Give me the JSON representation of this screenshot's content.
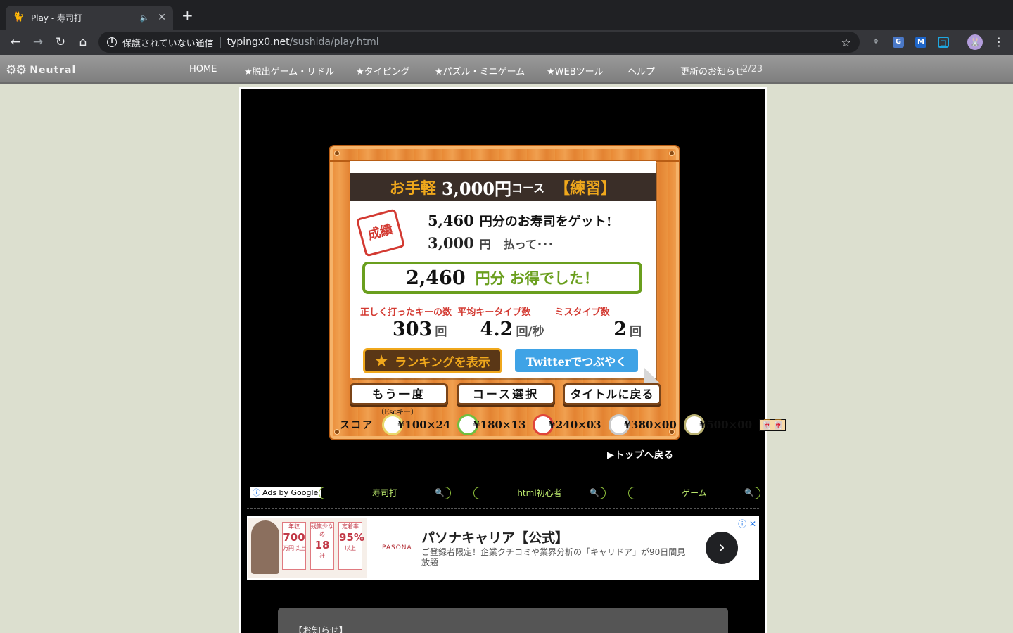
{
  "browser": {
    "tab_title": "Play - 寿司打",
    "tab_favicon": "🐈",
    "new_tab_icon": "+",
    "security_text": "保護されていない通信",
    "url_host": "typingx0.net",
    "url_path": "/sushida/play.html"
  },
  "site": {
    "logo": "Neutral",
    "nav": [
      "HOME",
      "★脱出ゲーム・リドル",
      "★タイピング",
      "★パズル・ミニゲーム",
      "★WEBツール",
      "ヘルプ",
      "更新のお知らせ",
      "2/23"
    ]
  },
  "result": {
    "course_name": "お手軽",
    "course_price": "3,000円",
    "course_suffix": "コース",
    "course_mode": "【練習】",
    "stamp": "成績",
    "earned_value": "5,460",
    "earned_suffix": "円分のお寿司をゲット!",
    "paid_value": "3,000",
    "paid_yen": "円",
    "paid_suffix": "払って･･･",
    "gain_value": "2,460",
    "gain_suffix": "円分 お得でした！",
    "stats": [
      {
        "label": "正しく打ったキーの数",
        "value": "303",
        "unit": "回"
      },
      {
        "label": "平均キータイプ数",
        "value": "4.2",
        "unit": "回/秒"
      },
      {
        "label": "ミスタイプ数",
        "value": "2",
        "unit": "回"
      }
    ],
    "ranking_button": "ランキングを表示",
    "twitter_button": "Twitterでつぶやく",
    "retry_button": "もう一度",
    "retry_hint": "（Escキー）",
    "course_select_button": "コース選択",
    "title_button": "タイトルに戻る",
    "score_label": "スコア",
    "plates": [
      {
        "price": "¥100",
        "count": "×24",
        "color": "#e8d86a"
      },
      {
        "price": "¥180",
        "count": "×13",
        "color": "#6fbf3f"
      },
      {
        "price": "¥240",
        "count": "×03",
        "color": "#e0443a"
      },
      {
        "price": "¥380",
        "count": "×00",
        "color": "#c8c8c8"
      },
      {
        "price": "¥500",
        "count": "×00",
        "color": "#b8b070"
      }
    ],
    "score_icons": "🀄🀄",
    "back_to_top": "▶トップへ戻る"
  },
  "ads": {
    "ads_by": "Ads by Google",
    "searches": [
      "寿司打",
      "html初心者",
      "ゲーム"
    ],
    "banner_title": "パソナキャリア【公式】",
    "banner_desc": "ご登録者限定！企業クチコミや業界分析の「キャリドア」が90日間見放題",
    "brand": "PASONA",
    "metrics": [
      {
        "top": "年収",
        "big": "700",
        "bottom": "万円以上"
      },
      {
        "top": "残業少なめ",
        "big": "18",
        "bottom": "社"
      },
      {
        "top": "定着率",
        "big": "95%",
        "bottom": "以上"
      }
    ]
  },
  "notice": {
    "title": "【お知らせ】"
  },
  "icons": {
    "back": "back-arrow-icon",
    "forward": "forward-arrow-icon",
    "reload": "reload-icon",
    "home": "home-icon",
    "info": "info-icon",
    "bookmark": "star-icon",
    "menu": "kebab-menu-icon",
    "search": "search-icon"
  },
  "colors": {
    "chrome_dark": "#202124",
    "board_orange": "#e98a35",
    "accent_orange": "#f0a81c",
    "gain_green": "#6a9f1e",
    "stat_red": "#d33a32",
    "twitter_blue": "#3fa3e6"
  }
}
